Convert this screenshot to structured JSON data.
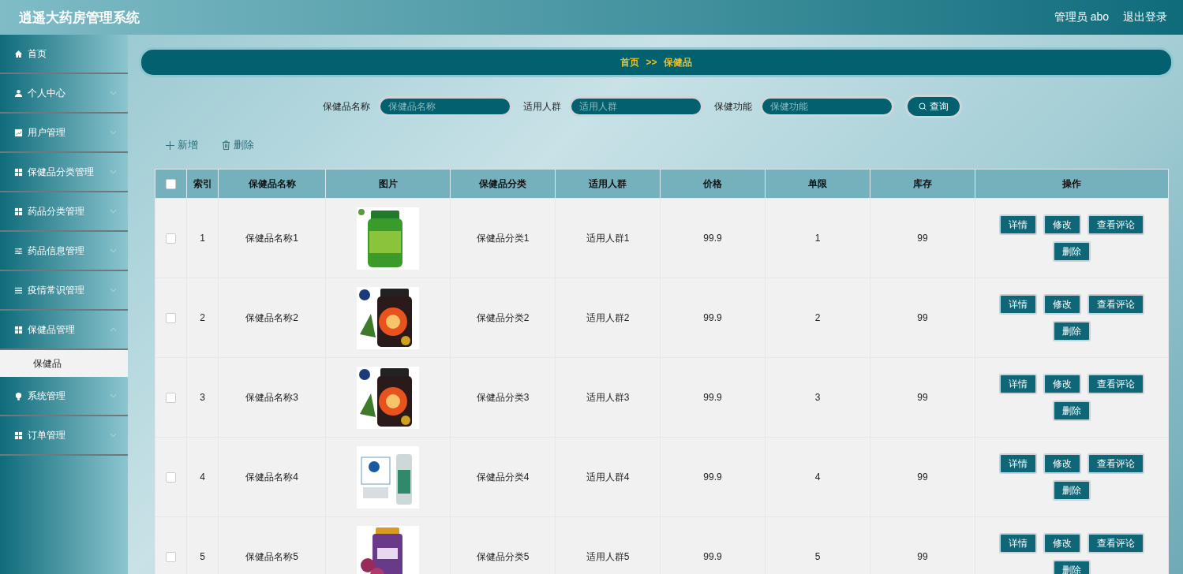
{
  "header": {
    "title": "逍遥大药房管理系统",
    "user": "管理员 abo",
    "logout": "退出登录"
  },
  "sidebar": {
    "items": [
      {
        "label": "首页",
        "kind": "home",
        "expandable": false,
        "expanded": false
      },
      {
        "label": "个人中心",
        "kind": "user",
        "expandable": true,
        "expanded": false
      },
      {
        "label": "用户管理",
        "kind": "chart",
        "expandable": true,
        "expanded": false
      },
      {
        "label": "保健品分类管理",
        "kind": "grid",
        "expandable": true,
        "expanded": false
      },
      {
        "label": "药品分类管理",
        "kind": "grid",
        "expandable": true,
        "expanded": false
      },
      {
        "label": "药品信息管理",
        "kind": "sliders",
        "expandable": true,
        "expanded": false
      },
      {
        "label": "疫情常识管理",
        "kind": "list",
        "expandable": true,
        "expanded": false
      },
      {
        "label": "保健品管理",
        "kind": "grid",
        "expandable": true,
        "expanded": true,
        "children": [
          {
            "label": "保健品",
            "selected": true
          }
        ]
      },
      {
        "label": "系统管理",
        "kind": "bulb",
        "expandable": true,
        "expanded": false
      },
      {
        "label": "订单管理",
        "kind": "grid",
        "expandable": true,
        "expanded": false
      }
    ]
  },
  "breadcrumb": [
    "首页",
    ">>",
    "保健品"
  ],
  "search": {
    "fields": [
      {
        "label": "保健品名称",
        "placeholder": "保健品名称"
      },
      {
        "label": "适用人群",
        "placeholder": "适用人群"
      },
      {
        "label": "保健功能",
        "placeholder": "保健功能"
      }
    ],
    "button": "查询"
  },
  "actions": [
    {
      "kind": "add",
      "label": "新增"
    },
    {
      "kind": "delete",
      "label": "删除"
    }
  ],
  "table": {
    "select_all_checked": false,
    "columns": [
      "索引",
      "保健品名称",
      "图片",
      "保健品分类",
      "适用人群",
      "价格",
      "单限",
      "库存",
      "操作"
    ],
    "rows": [
      {
        "checked": false,
        "cells": [
          "1",
          "保健品名称1",
          {
            "kind": "picture"
          },
          "保健品分类1",
          "适用人群1",
          "99.9",
          "1",
          "99"
        ],
        "buttons": [
          "详情",
          "修改",
          "查看评论",
          "删除"
        ]
      },
      {
        "checked": false,
        "cells": [
          "2",
          "保健品名称2",
          {
            "kind": "picture"
          },
          "保健品分类2",
          "适用人群2",
          "99.9",
          "2",
          "99"
        ],
        "buttons": [
          "详情",
          "修改",
          "查看评论",
          "删除"
        ]
      },
      {
        "checked": false,
        "cells": [
          "3",
          "保健品名称3",
          {
            "kind": "picture"
          },
          "保健品分类3",
          "适用人群3",
          "99.9",
          "3",
          "99"
        ],
        "buttons": [
          "详情",
          "修改",
          "查看评论",
          "删除"
        ]
      },
      {
        "checked": false,
        "cells": [
          "4",
          "保健品名称4",
          {
            "kind": "picture"
          },
          "保健品分类4",
          "适用人群4",
          "99.9",
          "4",
          "99"
        ],
        "buttons": [
          "详情",
          "修改",
          "查看评论",
          "删除"
        ]
      },
      {
        "checked": false,
        "cells": [
          "5",
          "保健品名称5",
          {
            "kind": "picture"
          },
          "保健品分类5",
          "适用人群5",
          "99.9",
          "5",
          "99"
        ],
        "buttons": [
          "详情",
          "修改",
          "查看评论",
          "删除"
        ]
      }
    ]
  }
}
